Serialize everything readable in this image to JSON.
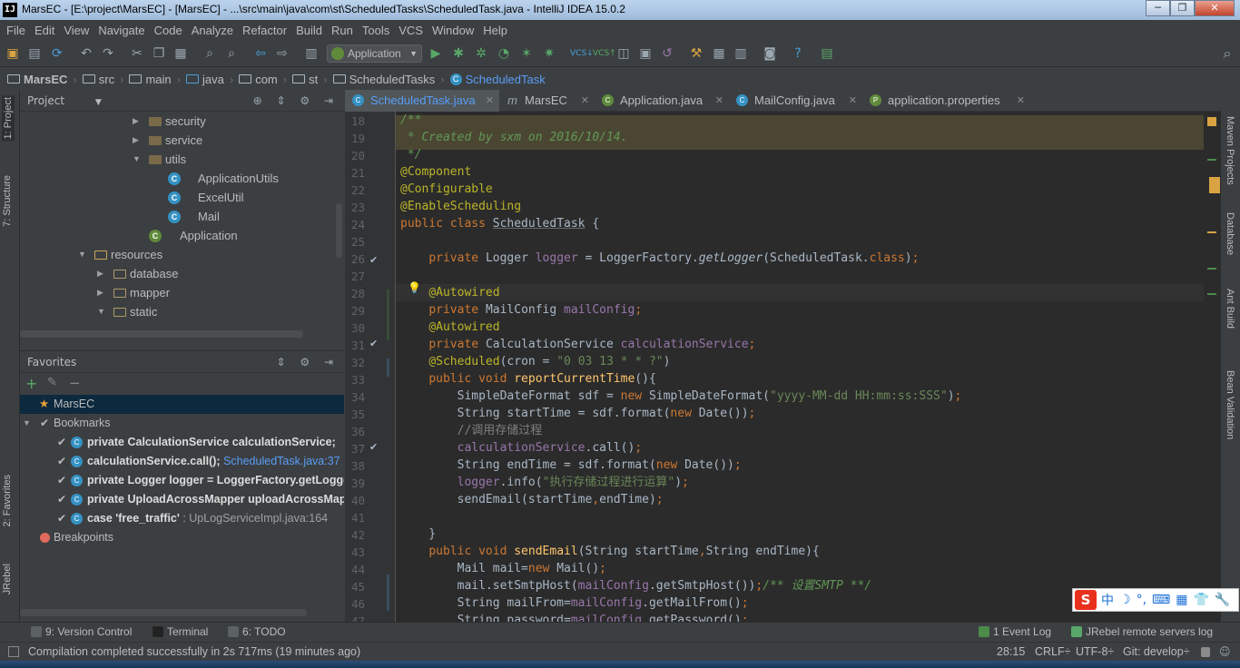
{
  "window": {
    "title": "MarsEC - [E:\\project\\MarsEC] - [MarsEC] - ...\\src\\main\\java\\com\\st\\ScheduledTasks\\ScheduledTask.java - IntelliJ IDEA 15.0.2",
    "app_icon": "IJ",
    "minimize": "─",
    "maximize": "❐",
    "close": "✕"
  },
  "menu": [
    "File",
    "Edit",
    "View",
    "Navigate",
    "Code",
    "Analyze",
    "Refactor",
    "Build",
    "Run",
    "Tools",
    "VCS",
    "Window",
    "Help"
  ],
  "toolbar": {
    "run_config": "Application",
    "icons": [
      "open-folder-icon",
      "save-icon",
      "sync-icon",
      "undo-icon",
      "redo-icon",
      "cut-icon",
      "copy-icon",
      "paste-icon",
      "find-icon",
      "replace-icon",
      "back-icon",
      "forward-icon",
      "make-icon",
      "run-icon",
      "debug-icon",
      "coverage-icon",
      "profile-icon",
      "jrebel-icon",
      "vcs-update-icon",
      "vcs-commit-icon",
      "vcs-compare-icon",
      "vcs-history-icon",
      "vcs-revert-icon",
      "settings-icon",
      "project-structure-icon",
      "sdk-icon",
      "android-icon",
      "help-icon",
      "tasks-icon"
    ],
    "search_icon": "⌕"
  },
  "breadcrumb": [
    "MarsEC",
    "src",
    "main",
    "java",
    "com",
    "st",
    "ScheduledTasks",
    "ScheduledTask"
  ],
  "left_strip": {
    "project": "1: Project",
    "structure": "7: Structure",
    "favorites": "2: Favorites",
    "jrebel": "JRebel"
  },
  "right_strip": {
    "maven": "Maven Projects",
    "database": "Database",
    "ant": "Ant Build",
    "bean": "Bean Validation"
  },
  "project_panel": {
    "title": "Project",
    "tree": [
      {
        "label": "security",
        "type": "package",
        "level": 3,
        "expanded": false
      },
      {
        "label": "service",
        "type": "package",
        "level": 3,
        "expanded": false
      },
      {
        "label": "utils",
        "type": "package",
        "level": 3,
        "expanded": true
      },
      {
        "label": "ApplicationUtils",
        "type": "class",
        "level": 4
      },
      {
        "label": "ExcelUtil",
        "type": "class",
        "level": 4
      },
      {
        "label": "Mail",
        "type": "class",
        "level": 4
      },
      {
        "label": "Application",
        "type": "app-class",
        "level": 3
      },
      {
        "label": "resources",
        "type": "folder",
        "level": 1,
        "expanded": true
      },
      {
        "label": "database",
        "type": "folder",
        "level": 2,
        "expanded": false
      },
      {
        "label": "mapper",
        "type": "folder",
        "level": 2,
        "expanded": false
      },
      {
        "label": "static",
        "type": "folder",
        "level": 2,
        "expanded": true
      }
    ]
  },
  "favorites_panel": {
    "title": "Favorites",
    "items": [
      {
        "label": "MarsEC",
        "type": "star",
        "selected": true
      },
      {
        "label": "Bookmarks",
        "type": "group"
      },
      {
        "bold": "private CalculationService calculationService;",
        "loc": "",
        "type": "bookmark"
      },
      {
        "bold": "calculationService.call();",
        "loc": " ScheduledTask.java:37",
        "type": "bookmark"
      },
      {
        "bold": "private Logger logger = LoggerFactory.getLogger(",
        "loc": "",
        "type": "bookmark"
      },
      {
        "bold": "private UploadAcrossMapper uploadAcrossMapper;",
        "loc": "",
        "type": "bookmark"
      },
      {
        "bold": "case  'free_traffic' ",
        "loc": ": UpLogServiceImpl.java:164",
        "type": "bookmark"
      },
      {
        "label": "Breakpoints",
        "type": "breakpoint"
      }
    ]
  },
  "tabs": [
    {
      "label": "ScheduledTask.java",
      "active": true,
      "icon": "C"
    },
    {
      "label": "MarsEC",
      "active": false,
      "icon": "m"
    },
    {
      "label": "Application.java",
      "active": false,
      "icon": "C"
    },
    {
      "label": "MailConfig.java",
      "active": false,
      "icon": "C"
    },
    {
      "label": "application.properties",
      "active": false,
      "icon": "P"
    }
  ],
  "editor": {
    "line_numbers": [
      "18",
      "19",
      "20",
      "21",
      "22",
      "23",
      "24",
      "25",
      "26",
      "27",
      "28",
      "29",
      "30",
      "31",
      "32",
      "33",
      "34",
      "35",
      "36",
      "37",
      "38",
      "39",
      "40",
      "41",
      "42",
      "43",
      "44",
      "45",
      "46",
      "47"
    ]
  },
  "bottom_tools": {
    "version_control": "9: Version Control",
    "terminal": "Terminal",
    "todo": "6: TODO",
    "event_log": "1  Event Log",
    "jrebel_log": "JRebel remote servers log"
  },
  "status": {
    "message": "Compilation completed successfully in 2s 717ms (19 minutes ago)",
    "position": "28:15",
    "line_sep": "CRLF÷",
    "encoding": "UTF-8÷",
    "git": "Git: develop÷"
  },
  "ime": {
    "logo": "S",
    "mode": "中",
    "moon": "☽",
    "punct": "°,",
    "keyboard": "⌨",
    "grid": "▦",
    "shirt": "👕",
    "wrench": "🔧"
  }
}
